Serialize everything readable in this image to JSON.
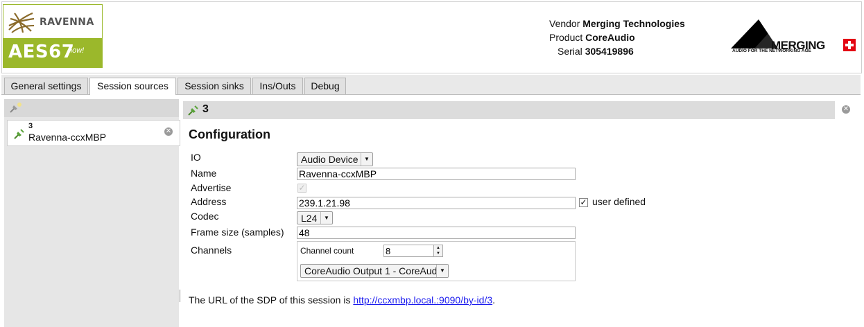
{
  "logo": {
    "brand": "RAVENNA",
    "title": "AES67",
    "tagline": "now!"
  },
  "device": {
    "vendor_label": "Vendor",
    "vendor": "Merging Technologies",
    "product_label": "Product",
    "product": "CoreAudio",
    "serial_label": "Serial",
    "serial": "305419896"
  },
  "merging_logo": {
    "name": "MERGING",
    "tagline": "AUDIO FOR THE NETWORKING AGE"
  },
  "tabs": [
    {
      "label": "General settings"
    },
    {
      "label": "Session sources"
    },
    {
      "label": "Session sinks"
    },
    {
      "label": "Ins/Outs"
    },
    {
      "label": "Debug"
    }
  ],
  "active_tab": "Session sources",
  "sources": [
    {
      "number": "3",
      "name": "Ravenna-ccxMBP"
    }
  ],
  "detail": {
    "number": "3",
    "section_title": "Configuration",
    "fields": {
      "io": {
        "label": "IO",
        "value": "Audio Device"
      },
      "name": {
        "label": "Name",
        "value": "Ravenna-ccxMBP"
      },
      "advertise": {
        "label": "Advertise",
        "checked": true,
        "disabled": true
      },
      "address": {
        "label": "Address",
        "value": "239.1.21.98",
        "user_defined_label": "user defined",
        "user_defined": true
      },
      "codec": {
        "label": "Codec",
        "value": "L24"
      },
      "frame_size": {
        "label": "Frame size (samples)",
        "value": "48"
      },
      "channels": {
        "label": "Channels",
        "count_label": "Channel count",
        "count": "8",
        "mapping": "CoreAudio Output 1 - CoreAud"
      }
    },
    "sdp": {
      "text": "The URL of the SDP of this session is ",
      "url": "http://ccxmbp.local.:9090/by-id/3",
      "suffix": "."
    }
  },
  "colors": {
    "aes_green": "#9bb82b",
    "link": "#1a1aee",
    "swiss_red": "#e30613"
  }
}
